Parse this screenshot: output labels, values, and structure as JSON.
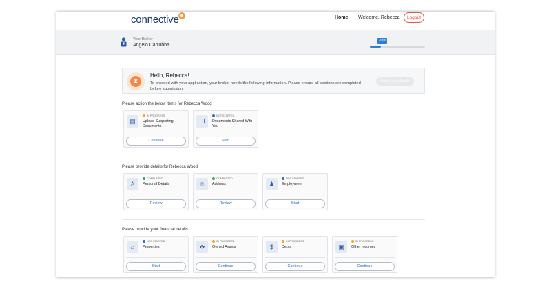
{
  "nav": {
    "logo": "connective",
    "home": "Home",
    "welcome": "Welcome, Rebecca",
    "logout": "Logout"
  },
  "broker": {
    "label": "Your Broker",
    "name": "Angelo Carrubba",
    "progress_text": "20%",
    "progress": 0.2
  },
  "hello": {
    "title": "Hello, Rebecca!",
    "text": "To proceed with your application, your broker needs the following information. Please ensure all sections are completed before submission.",
    "submit": "Submit your details"
  },
  "colors": {
    "in_progress": "#f5a623",
    "not_started": "#2f6fc7",
    "completed": "#3aa657"
  },
  "sections": [
    {
      "title": "Please action the below items for Rebecca Wood",
      "cards": [
        {
          "status": "IN PROGRESS",
          "status_type": "in_progress",
          "title": "Upload Supporting Documents",
          "button": "Continue",
          "icon": "document-upload-icon"
        },
        {
          "status": "NOT STARTED",
          "status_type": "not_started",
          "title": "Documents Shared With You",
          "button": "Start",
          "icon": "shared-documents-icon"
        }
      ]
    },
    {
      "title": "Please provide details for Rebecca Wood",
      "cards": [
        {
          "status": "COMPLETED",
          "status_type": "completed",
          "title": "Personal Details",
          "button": "Review",
          "icon": "person-details-icon"
        },
        {
          "status": "COMPLETED",
          "status_type": "completed",
          "title": "Address",
          "button": "Review",
          "icon": "address-pin-icon"
        },
        {
          "status": "NOT STARTED",
          "status_type": "not_started",
          "title": "Employment",
          "button": "Start",
          "icon": "employment-icon"
        }
      ]
    },
    {
      "title": "Please provide your financial details",
      "cards": [
        {
          "status": "NOT STARTED",
          "status_type": "not_started",
          "title": "Properties",
          "button": "Start",
          "icon": "properties-icon"
        },
        {
          "status": "IN PROGRESS",
          "status_type": "in_progress",
          "title": "Owned Assets",
          "button": "Continue",
          "icon": "owned-assets-icon"
        },
        {
          "status": "IN PROGRESS",
          "status_type": "in_progress",
          "title": "Debts",
          "button": "Continue",
          "icon": "debts-icon"
        },
        {
          "status": "IN PROGRESS",
          "status_type": "in_progress",
          "title": "Other Incomes",
          "button": "Continue",
          "icon": "other-incomes-icon"
        }
      ]
    }
  ]
}
